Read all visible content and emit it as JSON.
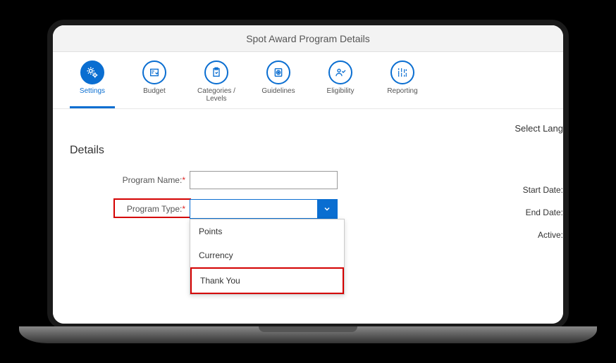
{
  "header": {
    "title": "Spot Award Program Details"
  },
  "nav": {
    "items": [
      {
        "label": "Settings"
      },
      {
        "label": "Budget"
      },
      {
        "label": "Categories / Levels"
      },
      {
        "label": "Guidelines"
      },
      {
        "label": "Eligibility"
      },
      {
        "label": "Reporting"
      }
    ]
  },
  "lang": {
    "label": "Select Lang"
  },
  "details": {
    "section_title": "Details",
    "program_name_label": "Program Name:",
    "program_type_label": "Program Type:",
    "required_marker": "*",
    "program_name_value": "",
    "program_type_value": "",
    "options": [
      "Points",
      "Currency",
      "Thank You"
    ]
  },
  "right": {
    "start_date_label": "Start Date:",
    "end_date_label": "End Date:",
    "active_label": "Active:"
  }
}
